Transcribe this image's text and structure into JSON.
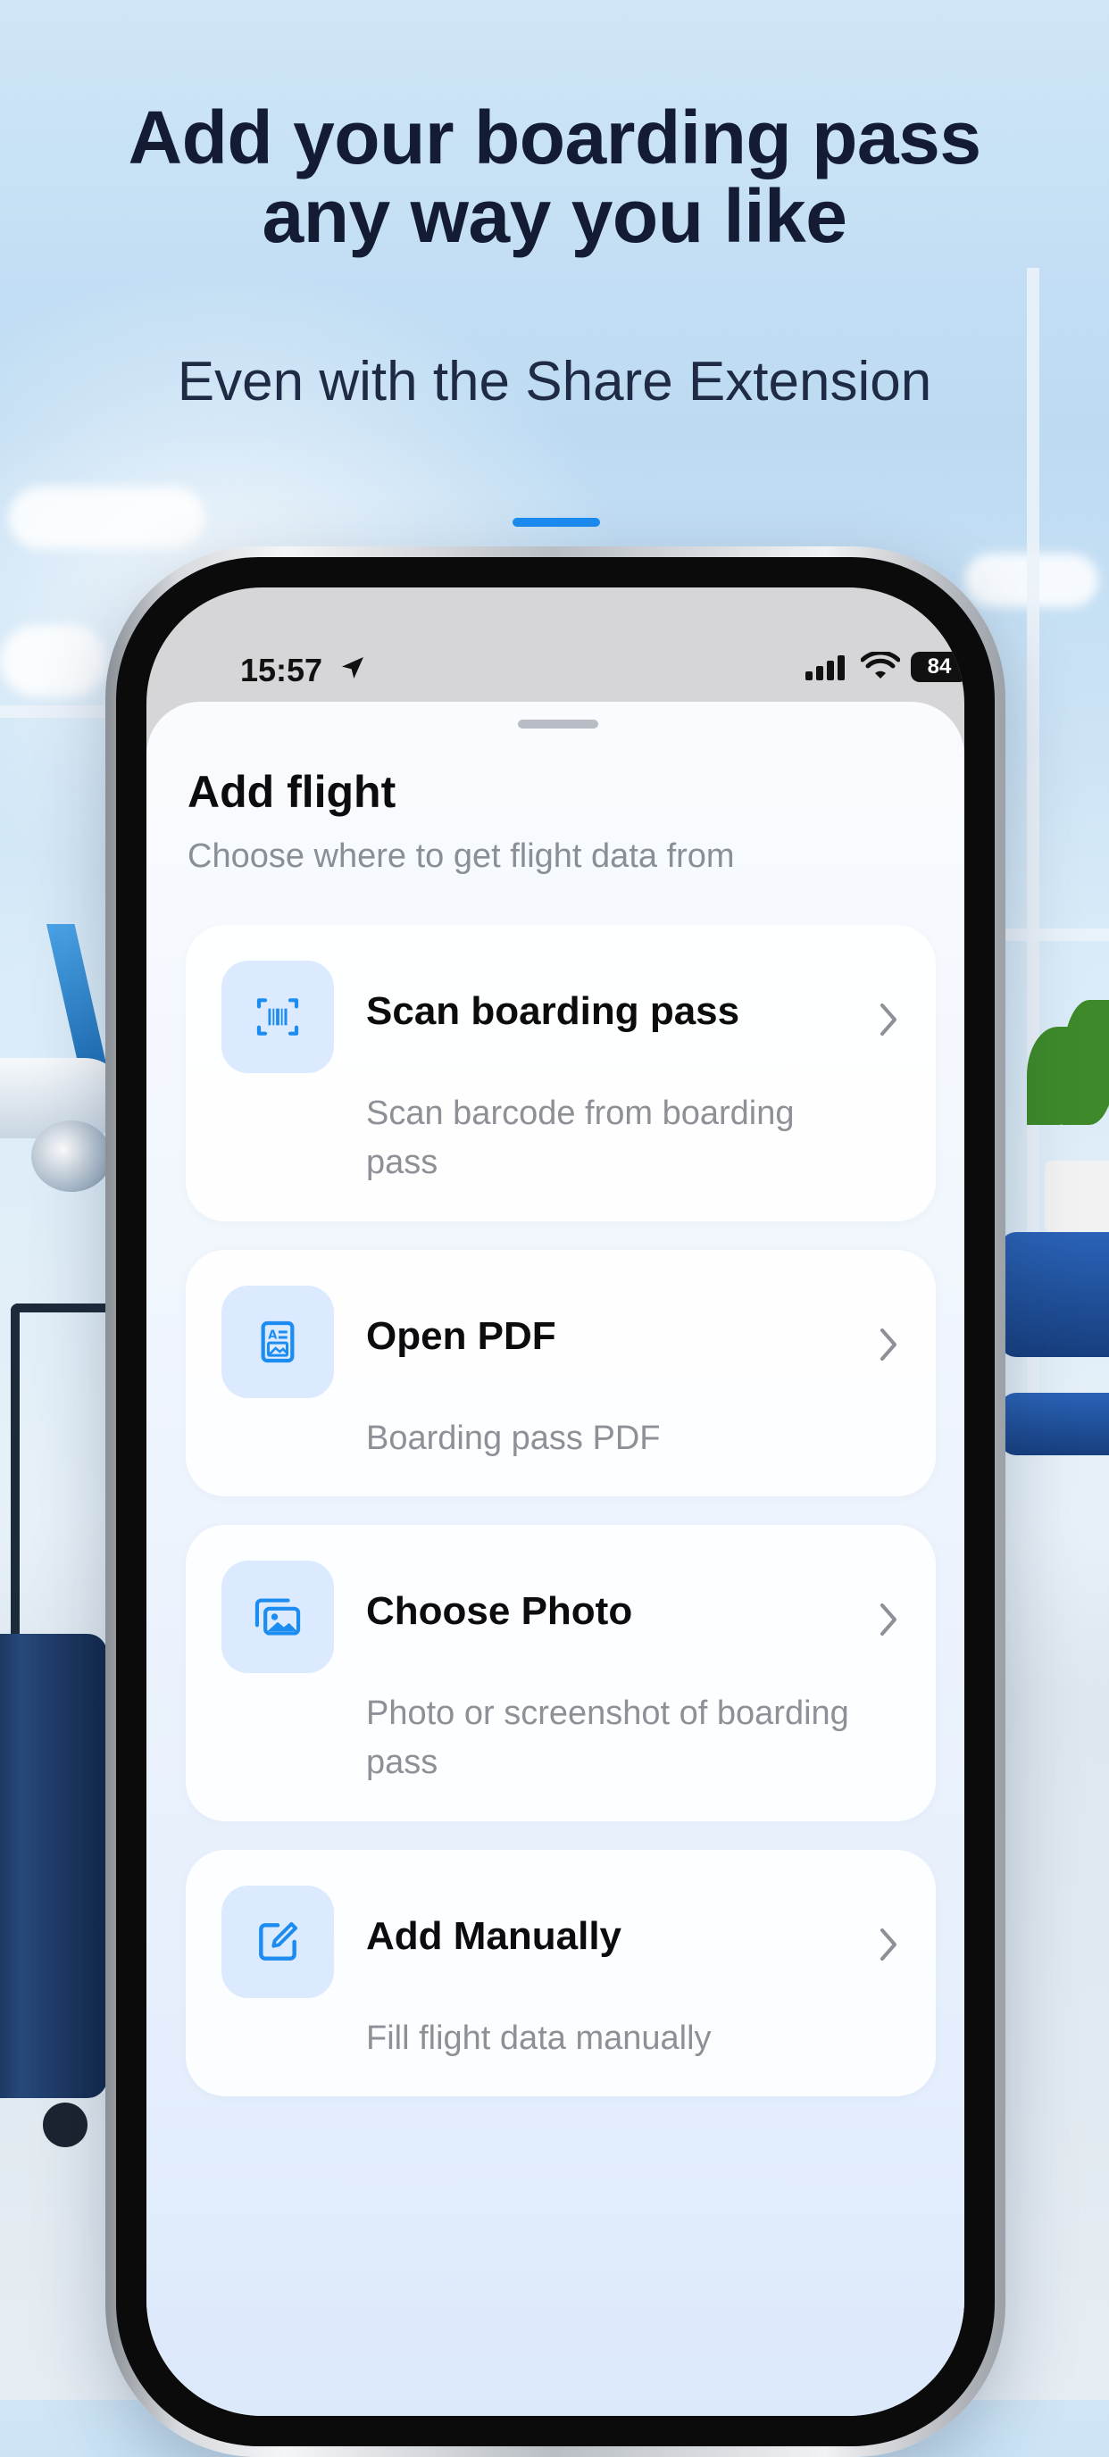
{
  "header": {
    "title_line1": "Add your boarding pass",
    "title_line2": "any way you like",
    "subtitle": "Even with the Share Extension"
  },
  "status_bar": {
    "time": "15:57",
    "battery": "84"
  },
  "sheet": {
    "title": "Add flight",
    "subtitle": "Choose where to get flight data from",
    "options": [
      {
        "title": "Scan boarding pass",
        "description": "Scan barcode from boarding pass",
        "icon": "barcode-scan-icon"
      },
      {
        "title": "Open PDF",
        "description": "Boarding pass PDF",
        "icon": "pdf-document-icon"
      },
      {
        "title": "Choose Photo",
        "description": "Photo or screenshot of boarding pass",
        "icon": "photo-stack-icon"
      },
      {
        "title": "Add Manually",
        "description": "Fill flight data manually",
        "icon": "edit-icon"
      }
    ]
  },
  "colors": {
    "accent": "#1c8cf0",
    "icon_background": "#dbeaff",
    "title_text": "#131c33",
    "secondary_text": "#8d9097"
  }
}
